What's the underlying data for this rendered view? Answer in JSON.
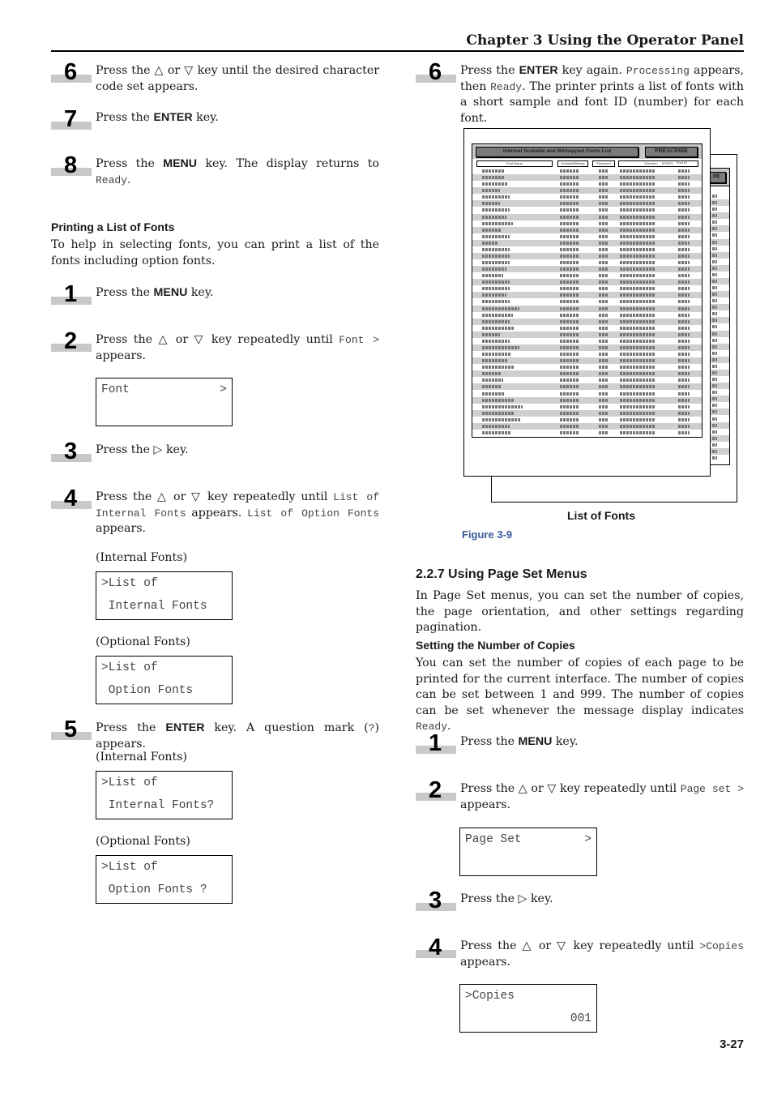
{
  "header": {
    "chapter": "Chapter 3  Using the Operator Panel"
  },
  "left": {
    "steps_top": [
      {
        "num": "6",
        "parts": [
          [
            "t",
            "Press the △ or ▽ key until the desired character code set appears."
          ]
        ]
      },
      {
        "num": "7",
        "parts": [
          [
            "t",
            "Press the "
          ],
          [
            "b",
            "ENTER"
          ],
          [
            "t",
            " key."
          ]
        ]
      },
      {
        "num": "8",
        "parts": [
          [
            "t",
            "Press the "
          ],
          [
            "b",
            "MENU"
          ],
          [
            "t",
            " key. The display returns to "
          ],
          [
            "m",
            "Ready"
          ],
          [
            "t",
            "."
          ]
        ]
      }
    ],
    "section_heading": "Printing a List of Fonts",
    "section_intro": "To help in selecting fonts, you can print a list of the fonts including option fonts.",
    "steps": [
      {
        "num": "1",
        "parts": [
          [
            "t",
            "Press the "
          ],
          [
            "b",
            "MENU"
          ],
          [
            "t",
            " key."
          ]
        ]
      },
      {
        "num": "2",
        "parts": [
          [
            "t",
            "Press the △ or ▽ key repeatedly until "
          ],
          [
            "m",
            "Font  >"
          ],
          [
            "t",
            " appears."
          ]
        ]
      },
      {
        "num": "3",
        "parts": [
          [
            "t",
            "Press the ▷ key."
          ]
        ]
      },
      {
        "num": "4",
        "parts": [
          [
            "t",
            "Press the △ or ▽ key repeatedly until "
          ],
          [
            "m",
            "List of Internal Fonts"
          ],
          [
            "t",
            " appears. "
          ],
          [
            "m",
            "List of Option Fonts"
          ],
          [
            "t",
            " appears."
          ]
        ]
      },
      {
        "num": "5",
        "parts": [
          [
            "t",
            "Press the "
          ],
          [
            "b",
            "ENTER"
          ],
          [
            "t",
            " key. A question mark ("
          ],
          [
            "m",
            "?"
          ],
          [
            "t",
            ") appears."
          ]
        ]
      }
    ],
    "lcd_font": {
      "line1": "Font",
      "line1_right": ">",
      "line2": ""
    },
    "caption_internal_1": "(Internal Fonts)",
    "lcd_internal_1": {
      "line1": ">List of",
      "line2": " Internal Fonts"
    },
    "caption_optional_1": "(Optional Fonts)",
    "lcd_optional_1": {
      "line1": ">List of",
      "line2": " Option Fonts"
    },
    "caption_internal_2": "(Internal Fonts)",
    "lcd_internal_2": {
      "line1": ">List of",
      "line2": " Internal Fonts?"
    },
    "caption_optional_2": "(Optional Fonts)",
    "lcd_optional_2": {
      "line1": ">List of",
      "line2": " Option Fonts ?"
    }
  },
  "right": {
    "step6": {
      "num": "6",
      "parts": [
        [
          "t",
          "Press the "
        ],
        [
          "b",
          "ENTER"
        ],
        [
          "t",
          " key again. "
        ],
        [
          "m",
          "Processing"
        ],
        [
          "t",
          " appears, then "
        ],
        [
          "m",
          "Ready"
        ],
        [
          "t",
          ". The printer prints a list of fonts with a short sample and font ID (number) for each font."
        ]
      ]
    },
    "figure": {
      "sheet_title": "Internal Scalable and Bitmapped Fonts List",
      "brand": "PRESCRIBE",
      "brand_partial": "BE",
      "columns": [
        "Font Name",
        "Scalable/Bitmap",
        "Password",
        "Selection     [PSET]",
        "Font ID"
      ],
      "row_count": 41,
      "caption": "List of Fonts",
      "number": "Figure 3-9"
    },
    "section_title": "2.2.7 Using Page Set Menus",
    "section_intro": "In Page Set menus, you can set the number of copies, the page orientation, and other settings regarding pagination.",
    "sub_heading": "Setting the Number of Copies",
    "sub_intro_parts": [
      [
        "t",
        "You can set the number of copies of each page to be printed for the current interface. The number of copies can be set between 1 and 999. The number of copies can be set whenever the message display indicates "
      ],
      [
        "m",
        "Ready"
      ],
      [
        "t",
        "."
      ]
    ],
    "steps": [
      {
        "num": "1",
        "parts": [
          [
            "t",
            "Press the "
          ],
          [
            "b",
            "MENU"
          ],
          [
            "t",
            " key."
          ]
        ]
      },
      {
        "num": "2",
        "parts": [
          [
            "t",
            "Press the △ or ▽ key repeatedly until "
          ],
          [
            "m",
            "Page set >"
          ],
          [
            "t",
            " appears."
          ]
        ]
      },
      {
        "num": "3",
        "parts": [
          [
            "t",
            "Press the ▷ key."
          ]
        ]
      },
      {
        "num": "4",
        "parts": [
          [
            "t",
            "Press the △ or ▽ key repeatedly until "
          ],
          [
            "m",
            ">Copies"
          ],
          [
            "t",
            " appears."
          ]
        ]
      }
    ],
    "lcd_pageset": {
      "line1": "Page Set",
      "line1_right": ">",
      "line2": ""
    },
    "lcd_copies": {
      "line1": ">Copies",
      "line2_right": "001"
    }
  },
  "footer": {
    "page_number": "3-27"
  }
}
